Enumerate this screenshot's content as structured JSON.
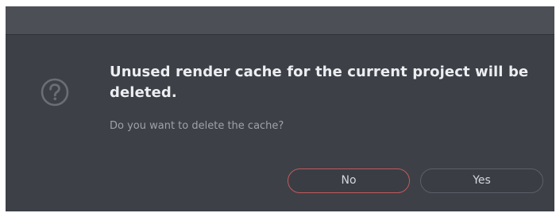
{
  "dialog": {
    "icon": "question-circle-icon",
    "message": "Unused render cache for the current project will be deleted.",
    "question": "Do you want to delete the cache?",
    "buttons": {
      "no_label": "No",
      "yes_label": "Yes"
    }
  },
  "colors": {
    "dialog_background": "#3d4047",
    "titlebar_background": "#4c4f56",
    "primary_text": "#eceef1",
    "secondary_text": "#9ea2a9",
    "focus_border": "#c45a5a"
  }
}
